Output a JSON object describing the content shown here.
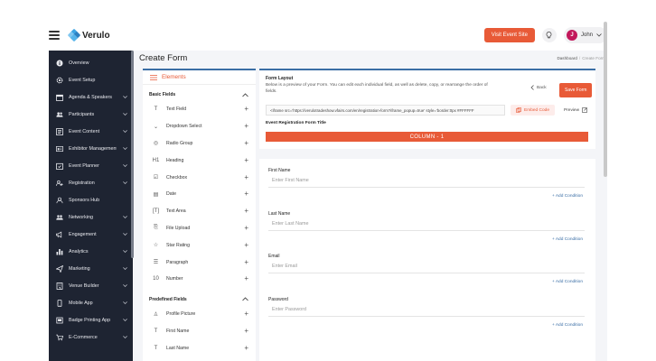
{
  "header": {
    "app_name": "Verulo",
    "visit_button": "Visit Event Site",
    "user_initial": "J",
    "user_name": "John"
  },
  "sidebar": {
    "items": [
      {
        "label": "Overview",
        "icon": "info-icon",
        "has_chevron": false
      },
      {
        "label": "Event Setup",
        "icon": "gear-icon",
        "has_chevron": false
      },
      {
        "label": "Agenda & Speakers",
        "icon": "calendar-icon",
        "has_chevron": true
      },
      {
        "label": "Participants",
        "icon": "people-icon",
        "has_chevron": true
      },
      {
        "label": "Event Content",
        "icon": "document-icon",
        "has_chevron": true
      },
      {
        "label": "Exhibitor Management",
        "icon": "booth-icon",
        "has_chevron": true
      },
      {
        "label": "Event Planner",
        "icon": "planner-icon",
        "has_chevron": true
      },
      {
        "label": "Registration",
        "icon": "user-add-icon",
        "has_chevron": true
      },
      {
        "label": "Sponsors Hub",
        "icon": "sponsors-icon",
        "has_chevron": false
      },
      {
        "label": "Networking",
        "icon": "network-icon",
        "has_chevron": true
      },
      {
        "label": "Engagement",
        "icon": "megaphone-icon",
        "has_chevron": true
      },
      {
        "label": "Analytics",
        "icon": "bar-chart-icon",
        "has_chevron": true
      },
      {
        "label": "Marketing",
        "icon": "send-icon",
        "has_chevron": true
      },
      {
        "label": "Venue Builder",
        "icon": "building-icon",
        "has_chevron": true
      },
      {
        "label": "Mobile App",
        "icon": "mobile-icon",
        "has_chevron": true
      },
      {
        "label": "Badge Printing App",
        "icon": "badge-icon",
        "has_chevron": true
      },
      {
        "label": "E-Commerce",
        "icon": "cart-icon",
        "has_chevron": true
      }
    ]
  },
  "page": {
    "title": "Create Form",
    "breadcrumb": [
      "Dashboard",
      "Create Form"
    ]
  },
  "elements_panel": {
    "title": "Elements",
    "basic_section": "Basic Fields",
    "basic_fields": [
      {
        "label": "Text Field",
        "glyph": "T"
      },
      {
        "label": "Dropdown Select",
        "glyph": "⌄"
      },
      {
        "label": "Radio Group",
        "glyph": "◎"
      },
      {
        "label": "Heading",
        "glyph": "H1"
      },
      {
        "label": "Checkbox",
        "glyph": "☑"
      },
      {
        "label": "Date",
        "glyph": "▤"
      },
      {
        "label": "Text Area",
        "glyph": "[T]"
      },
      {
        "label": "File Upload",
        "glyph": "⎘"
      },
      {
        "label": "Star Rating",
        "glyph": "☆"
      },
      {
        "label": "Paragraph",
        "glyph": "☰"
      },
      {
        "label": "Number",
        "glyph": "10"
      }
    ],
    "predefined_section": "Predefined Fields",
    "predefined_fields": [
      {
        "label": "Profile Picture",
        "glyph": "♙"
      },
      {
        "label": "First Name",
        "glyph": "T"
      },
      {
        "label": "Last Name",
        "glyph": "T"
      }
    ]
  },
  "form_layout": {
    "title": "Form Layout",
    "description": "Below is a preview of your Form. You can edit each individual field, as well as delete, copy, or rearrange the order of fields.",
    "back_label": "Back",
    "save_label": "Save Form",
    "embed_code": "<iframe src='https://verulotradeshow.vfairs.com/en/registration-form?iframe_popup=true' style='border:0px #FFFFFF",
    "embed_button": "Embed Code",
    "preview_label": "Preview",
    "reg_title_label": "Event Registration Form Title",
    "column_label": "COLUMN - 1"
  },
  "fields": [
    {
      "label": "First Name",
      "placeholder": "Enter First Name",
      "add_condition": "+ Add Condition"
    },
    {
      "label": "Last Name",
      "placeholder": "Enter Last Name",
      "add_condition": "+ Add Condition"
    },
    {
      "label": "Email",
      "placeholder": "Enter Email",
      "add_condition": "+ Add Condition"
    },
    {
      "label": "Password",
      "placeholder": "Enter Password",
      "add_condition": "+ Add Condition"
    }
  ],
  "colors": {
    "accent": "#e85a37",
    "sidebar": "#1e2432",
    "link": "#3a6ea5"
  }
}
